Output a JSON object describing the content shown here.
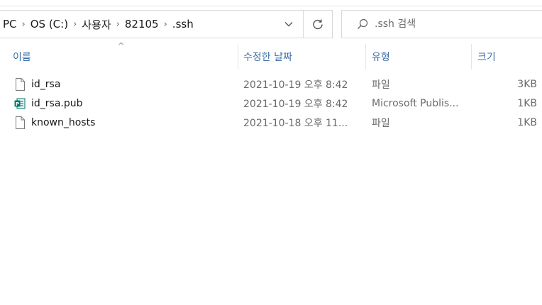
{
  "addressbar": {
    "crumbs": [
      "PC",
      "OS (C:)",
      "사용자",
      "82105",
      ".ssh"
    ],
    "separator": "›"
  },
  "search": {
    "placeholder": ".ssh 검색"
  },
  "columns": {
    "name": "이름",
    "date": "수정한 날짜",
    "type": "유형",
    "size": "크기"
  },
  "files": [
    {
      "name": "id_rsa",
      "date": "2021-10-19 오후 8:42",
      "type": "파일",
      "size": "3KB",
      "icon": "blank-file-icon"
    },
    {
      "name": "id_rsa.pub",
      "date": "2021-10-19 오후 8:42",
      "type": "Microsoft Publis...",
      "size": "1KB",
      "icon": "publisher-file-icon"
    },
    {
      "name": "known_hosts",
      "date": "2021-10-18 오후 11...",
      "type": "파일",
      "size": "1KB",
      "icon": "blank-file-icon"
    }
  ],
  "colors": {
    "header_text": "#3d6fa8",
    "publisher_icon": "#077568"
  }
}
